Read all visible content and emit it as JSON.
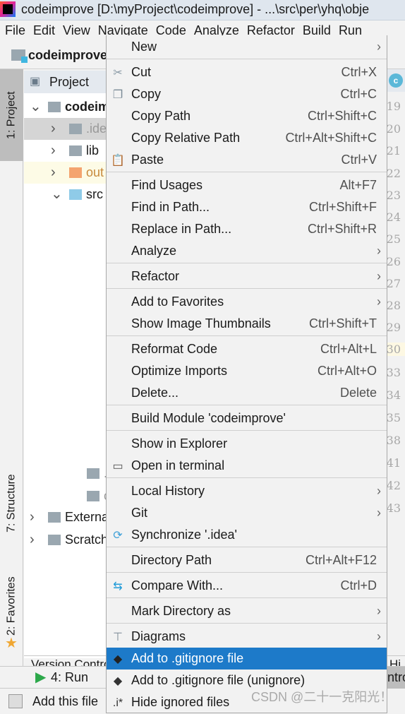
{
  "window": {
    "title": "codeimprove [D:\\myProject\\codeimprove] - ...\\src\\per\\yhq\\obje"
  },
  "menubar": [
    "File",
    "Edit",
    "View",
    "Navigate",
    "Code",
    "Analyze",
    "Refactor",
    "Build",
    "Run"
  ],
  "navbar": {
    "project": "codeimprove"
  },
  "tool_strip": {
    "project": "1: Project",
    "structure": "7: Structure",
    "favorites": "2: Favorites"
  },
  "project_panel": {
    "title": "Project",
    "rows": [
      {
        "label": "codeimprove",
        "expanded": true
      },
      {
        "label": ".idea",
        "expanded": false
      },
      {
        "label": "lib",
        "expanded": false
      },
      {
        "label": "out",
        "expanded": false
      },
      {
        "label": "src",
        "expanded": true
      },
      {
        "label": ".gitignore"
      },
      {
        "label": "codeimprove.iml"
      },
      {
        "label": "External Libraries",
        "expanded": false
      },
      {
        "label": "Scratches and Consoles",
        "expanded": false
      }
    ]
  },
  "gutter": [
    "19",
    "20",
    "21",
    "22",
    "23",
    "24",
    "25",
    "26",
    "27",
    "28",
    "29",
    "30",
    "33",
    "34",
    "35",
    "38",
    "41",
    "42",
    "43"
  ],
  "bottom": {
    "version_control": "Version Control",
    "run": "4: Run",
    "status": "Add this file",
    "right_tab": "Hi",
    "right_tab2": "ntro"
  },
  "context_menu": [
    [
      {
        "label": "New",
        "submenu": true
      }
    ],
    [
      {
        "label": "Cut",
        "shortcut": "Ctrl+X",
        "icon": "scissors-icon"
      },
      {
        "label": "Copy",
        "shortcut": "Ctrl+C",
        "icon": "copy-icon"
      },
      {
        "label": "Copy Path",
        "shortcut": "Ctrl+Shift+C"
      },
      {
        "label": "Copy Relative Path",
        "shortcut": "Ctrl+Alt+Shift+C"
      },
      {
        "label": "Paste",
        "shortcut": "Ctrl+V",
        "icon": "paste-icon"
      }
    ],
    [
      {
        "label": "Find Usages",
        "shortcut": "Alt+F7"
      },
      {
        "label": "Find in Path...",
        "shortcut": "Ctrl+Shift+F"
      },
      {
        "label": "Replace in Path...",
        "shortcut": "Ctrl+Shift+R"
      },
      {
        "label": "Analyze",
        "submenu": true
      }
    ],
    [
      {
        "label": "Refactor",
        "submenu": true
      }
    ],
    [
      {
        "label": "Add to Favorites",
        "submenu": true
      },
      {
        "label": "Show Image Thumbnails",
        "shortcut": "Ctrl+Shift+T"
      }
    ],
    [
      {
        "label": "Reformat Code",
        "shortcut": "Ctrl+Alt+L"
      },
      {
        "label": "Optimize Imports",
        "shortcut": "Ctrl+Alt+O"
      },
      {
        "label": "Delete...",
        "shortcut": "Delete"
      }
    ],
    [
      {
        "label": "Build Module 'codeimprove'"
      }
    ],
    [
      {
        "label": "Show in Explorer"
      },
      {
        "label": "Open in terminal",
        "icon": "terminal-icon"
      }
    ],
    [
      {
        "label": "Local History",
        "submenu": true
      },
      {
        "label": "Git",
        "submenu": true
      },
      {
        "label": "Synchronize '.idea'",
        "icon": "sync-icon"
      }
    ],
    [
      {
        "label": "Directory Path",
        "shortcut": "Ctrl+Alt+F12"
      }
    ],
    [
      {
        "label": "Compare With...",
        "shortcut": "Ctrl+D",
        "icon": "compare-icon"
      }
    ],
    [
      {
        "label": "Mark Directory as",
        "submenu": true
      }
    ],
    [
      {
        "label": "Diagrams",
        "submenu": true,
        "icon": "diagram-icon"
      },
      {
        "label": "Add to .gitignore file",
        "icon": "git-icon",
        "selected": true
      },
      {
        "label": "Add to .gitignore file (unignore)",
        "icon": "git-icon"
      },
      {
        "label": "Hide ignored files",
        "icon": "ignored-icon"
      }
    ]
  ],
  "watermark": "CSDN @二十一克阳光！",
  "colors": {
    "selection": "#1d7ac9",
    "menu_bg": "#f2f2f2"
  }
}
